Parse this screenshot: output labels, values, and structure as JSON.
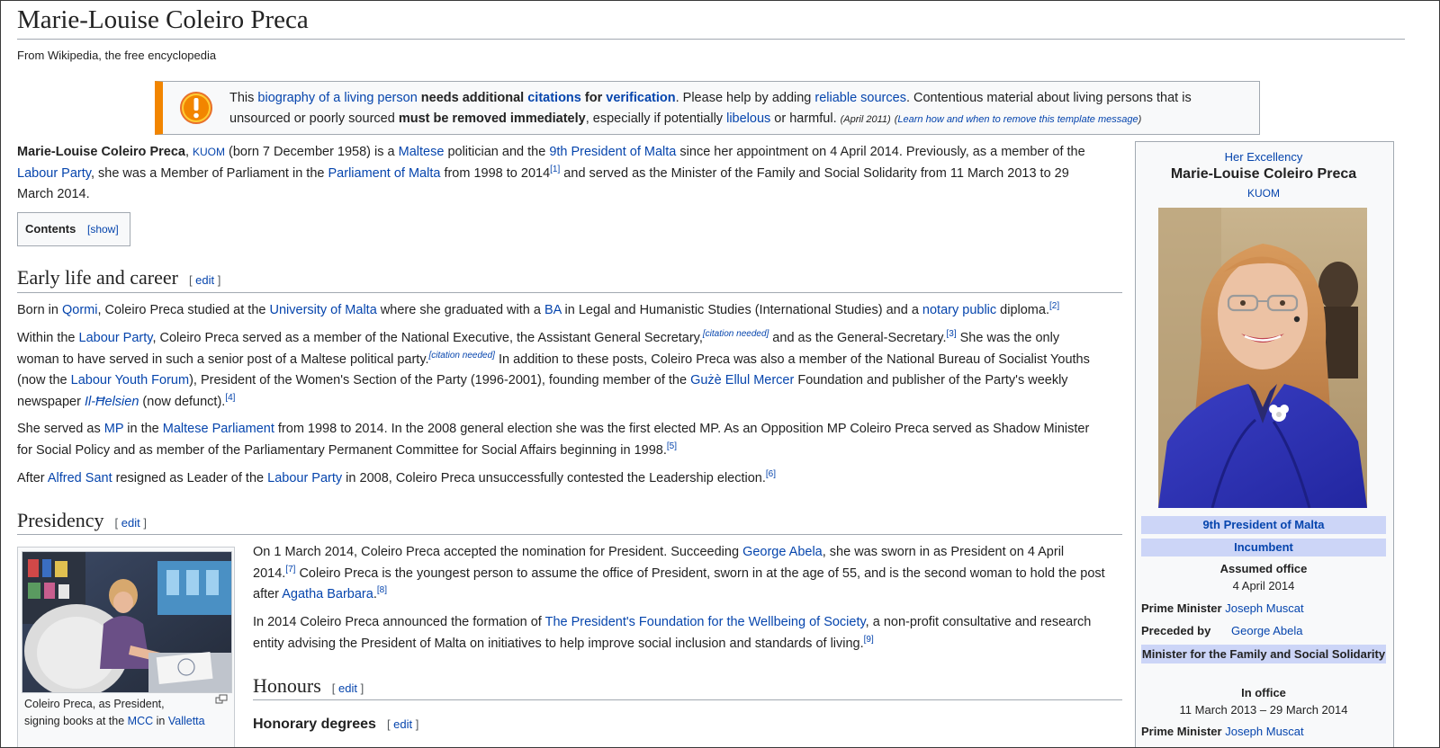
{
  "page": {
    "title": "Marie-Louise Coleiro Preca",
    "tagline": "From Wikipedia, the free encyclopedia"
  },
  "notice": {
    "icon": "warning-icon",
    "color": "#f28500",
    "line1": {
      "t1": "This ",
      "link1": "biography of a living person",
      "t2": " needs additional ",
      "link2": "citations",
      "t3": " for ",
      "link3": "verification",
      "t4": ". Please help by adding ",
      "link4": "reliable sources",
      "t5": ". Contentious material about living persons that is"
    },
    "line2": {
      "t1": "unsourced or poorly sourced ",
      "bold": "must be removed immediately",
      "t2": ", especially if potentially ",
      "link1": "libelous",
      "t3": " or harmful.",
      "date": "(April 2011)",
      "paren_open": "(",
      "learn": "Learn how and when to remove this template message",
      "paren_close": ")"
    }
  },
  "intro": {
    "name": "Marie-Louise Coleiro Preca",
    "kuom": "KUOM",
    "t1": " (born 7 December 1958) is a ",
    "maltese": "Maltese",
    "t2": " politician and the ",
    "ninth": "9th President of Malta",
    "t3": " since her appointment on 4 April 2014. Previously, as a member of the",
    "labour": "Labour Party",
    "t4": ", she was a Member of Parliament in the ",
    "parliament": "Parliament of Malta",
    "t5": " from 1998 to 2014",
    "ref1": "[1]",
    "t6": " and served as the Minister of the Family and Social Solidarity from 11 March 2013 to 29",
    "t7": "March 2014."
  },
  "toc": {
    "title": "Contents",
    "toggle": "[show]"
  },
  "sections": {
    "early": {
      "heading": "Early life and career",
      "edit_open": "[ ",
      "edit": "edit",
      "edit_close": " ]"
    },
    "presidency": {
      "heading": "Presidency",
      "edit_open": "[ ",
      "edit": "edit",
      "edit_close": " ]"
    },
    "honours": {
      "heading": "Honours",
      "edit_open": "[ ",
      "edit": "edit",
      "edit_close": " ]"
    },
    "degrees": {
      "heading": "Honorary degrees",
      "edit_open": "[ ",
      "edit": "edit",
      "edit_close": " ]"
    }
  },
  "early": {
    "p1": {
      "t1": "Born in ",
      "qormi": "Qormi",
      "t2": ", Coleiro Preca studied at the ",
      "uni": "University of Malta",
      "t3": " where she graduated with a ",
      "ba": "BA",
      "t4": " in Legal and Humanistic Studies (International Studies) and a ",
      "notary": "notary public",
      "t5": " diploma.",
      "ref": "[2]"
    },
    "p2": {
      "t1": "Within the ",
      "labour": "Labour Party",
      "t2": ", Coleiro Preca served as a member of the National Executive, the Assistant General Secretary,",
      "cn1": "[citation needed]",
      "t3": " and as the General-Secretary.",
      "ref3": "[3]",
      "t4": " She was the only",
      "t5": "woman to have served in such a senior post of a Maltese political party.",
      "cn2": "[citation needed]",
      "t6": " In addition to these posts, Coleiro Preca was also a member of the National Bureau of Socialist Youths",
      "t7": "(now the ",
      "lyf": "Labour Youth Forum",
      "t8": "), President of the Women's Section of the Party (1996-2001), founding member of the ",
      "guze": "Gużè Ellul Mercer",
      "t9": " Foundation and publisher of the Party's weekly",
      "t10": "newspaper ",
      "helsien": "Il-Ħelsien",
      "t11": " (now defunct).",
      "ref4": "[4]"
    },
    "p3": {
      "t1": "She served as ",
      "mp": "MP",
      "t2": " in the ",
      "mparl": "Maltese Parliament",
      "t3": " from 1998 to 2014. In the 2008 general election she was the first elected MP. As an Opposition MP Coleiro Preca served as Shadow Minister",
      "t4": "for Social Policy and as member of the Parliamentary Permanent Committee for Social Affairs beginning in 1998.",
      "ref5": "[5]"
    },
    "p4": {
      "t1": "After ",
      "sant": "Alfred Sant",
      "t2": " resigned as Leader of the ",
      "labour": "Labour Party",
      "t3": " in 2008, Coleiro Preca unsuccessfully contested the Leadership election.",
      "ref6": "[6]"
    }
  },
  "presidency": {
    "p1": {
      "t1": "On 1 March 2014, Coleiro Preca accepted the nomination for President. Succeeding ",
      "abela": "George Abela",
      "t2": ", she was sworn in as President on 4 April",
      "t3": "2014.",
      "ref7": "[7]",
      "t4": " Coleiro Preca is the youngest person to assume the office of President, sworn in at the age of 55, and is the second woman to hold the post",
      "t5": "after ",
      "barbara": "Agatha Barbara",
      "t6": ".",
      "ref8": "[8]"
    },
    "p2": {
      "t1": "In 2014 Coleiro Preca announced the formation of ",
      "foundation": "The President's Foundation for the Wellbeing of Society",
      "t2": ", a non-profit consultative and research",
      "t3": "entity advising the President of Malta on initiatives to help improve social inclusion and standards of living.",
      "ref9": "[9]"
    },
    "thumb": {
      "caption_l1": "Coleiro Preca, as President,",
      "caption_t1": "signing books at the ",
      "mcc": "MCC",
      "caption_t2": " in ",
      "valletta": "Valletta",
      "enlarge_icon": "enlarge-icon"
    }
  },
  "infobox": {
    "honorific": "Her Excellency",
    "name": "Marie-Louise Coleiro Preca",
    "post_nominal": "KUOM",
    "office": "9th President of Malta",
    "status": "Incumbent",
    "assumed_label": "Assumed office",
    "assumed_date": "4 April 2014",
    "pm_label": "Prime Minister",
    "pm_value": "Joseph Muscat",
    "preceded_label": "Preceded by",
    "preceded_value": "George Abela",
    "office2": "Minister for the Family and Social Solidarity",
    "inoffice_label": "In office",
    "inoffice_dates": "11 March 2013 – 29 March 2014",
    "pm2_label": "Prime Minister",
    "pm2_value": "Joseph Muscat"
  },
  "colors": {
    "link": "#0645ad",
    "band": "#ccd5f7",
    "rule": "#a2a9b1"
  }
}
